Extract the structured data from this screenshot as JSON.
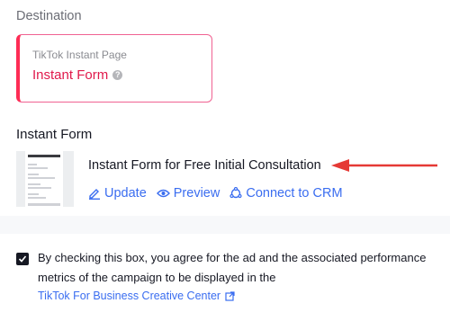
{
  "destination": {
    "title": "Destination",
    "card_sub": "TikTok Instant Page",
    "card_main": "Instant Form"
  },
  "instant_form": {
    "title": "Instant Form",
    "form_name": "Instant Form for Free Initial Consultation",
    "actions": {
      "update": "Update",
      "preview": "Preview",
      "connect": "Connect to CRM"
    }
  },
  "consent": {
    "text": "By checking this box, you agree for the ad and the associated performance metrics of the campaign to be displayed in the",
    "link": "TikTok For Business Creative Center",
    "checked": true
  },
  "colors": {
    "accent_pink": "#fe2c55",
    "link_blue": "#3a6df0",
    "arrow_red": "#e53935"
  },
  "icons": [
    "help-icon",
    "pencil-icon",
    "eye-icon",
    "crm-icon",
    "external-link-icon",
    "checkmark-icon",
    "arrow-icon"
  ]
}
